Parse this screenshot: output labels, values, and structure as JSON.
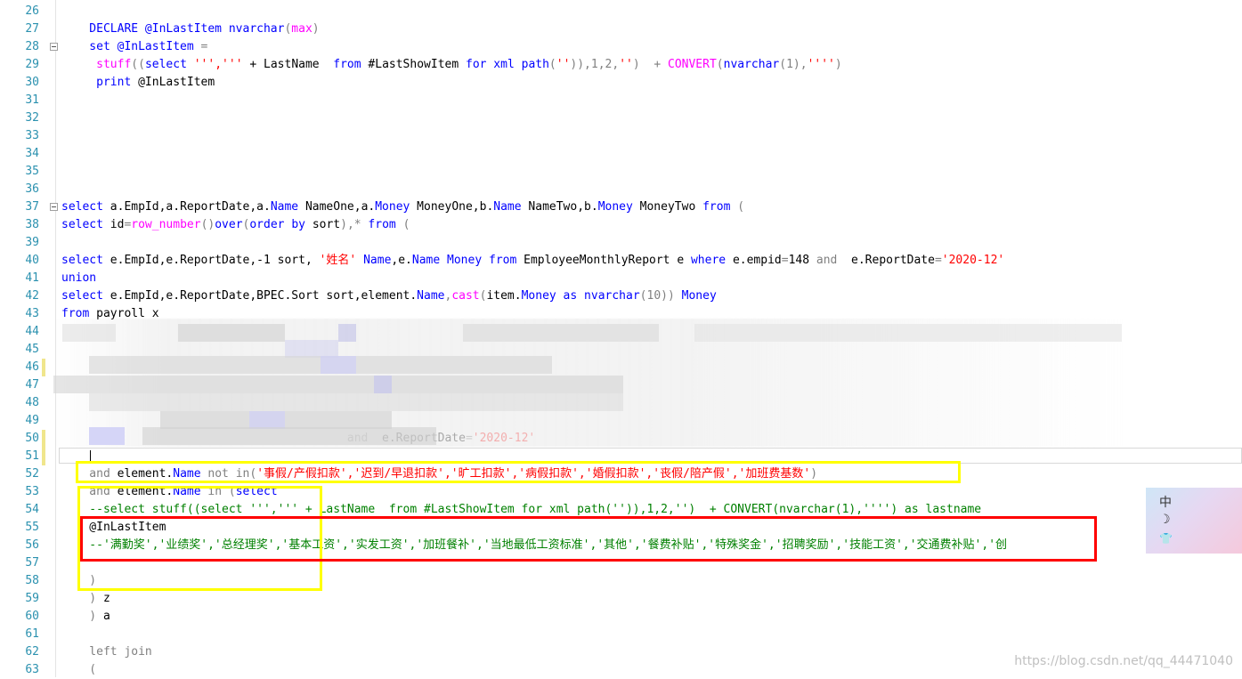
{
  "lines": [
    {
      "n": "26",
      "segs": []
    },
    {
      "n": "27",
      "segs": [
        {
          "t": "    DECLARE @InLastItem ",
          "c": "kw"
        },
        {
          "t": "nvarchar",
          "c": "kw"
        },
        {
          "t": "(",
          "c": "gr"
        },
        {
          "t": "max",
          "c": "fn"
        },
        {
          "t": ")",
          "c": "gr"
        }
      ]
    },
    {
      "n": "28",
      "segs": [
        {
          "t": "    set @InLastItem ",
          "c": "kw"
        },
        {
          "t": "=",
          "c": "gr"
        }
      ]
    },
    {
      "n": "29",
      "segs": [
        {
          "t": "     stuff",
          "c": "fn"
        },
        {
          "t": "((",
          "c": "gr"
        },
        {
          "t": "select ",
          "c": "kw"
        },
        {
          "t": "''','''",
          "c": "str"
        },
        {
          "t": " + LastName  ",
          "c": ""
        },
        {
          "t": "from ",
          "c": "kw"
        },
        {
          "t": "#LastShowItem ",
          "c": ""
        },
        {
          "t": "for xml path",
          "c": "kw"
        },
        {
          "t": "(",
          "c": "gr"
        },
        {
          "t": "''",
          "c": "str"
        },
        {
          "t": ")),1,2,",
          "c": "gr"
        },
        {
          "t": "''",
          "c": "str"
        },
        {
          "t": ")  + ",
          "c": "gr"
        },
        {
          "t": "CONVERT",
          "c": "fn"
        },
        {
          "t": "(",
          "c": "gr"
        },
        {
          "t": "nvarchar",
          "c": "kw"
        },
        {
          "t": "(1),",
          "c": "gr"
        },
        {
          "t": "''''",
          "c": "str"
        },
        {
          "t": ")",
          "c": "gr"
        }
      ]
    },
    {
      "n": "30",
      "segs": [
        {
          "t": "     print ",
          "c": "kw"
        },
        {
          "t": "@InLastItem",
          "c": ""
        }
      ]
    },
    {
      "n": "31",
      "segs": []
    },
    {
      "n": "32",
      "segs": []
    },
    {
      "n": "33",
      "segs": []
    },
    {
      "n": "34",
      "segs": []
    },
    {
      "n": "35",
      "segs": []
    },
    {
      "n": "36",
      "segs": []
    },
    {
      "n": "37",
      "segs": [
        {
          "t": "select ",
          "c": "kw"
        },
        {
          "t": "a.EmpId,a.ReportDate,a.",
          "c": ""
        },
        {
          "t": "Name",
          "c": "kw"
        },
        {
          "t": " NameOne,a.",
          "c": ""
        },
        {
          "t": "Money",
          "c": "kw"
        },
        {
          "t": " MoneyOne,b.",
          "c": ""
        },
        {
          "t": "Name",
          "c": "kw"
        },
        {
          "t": " NameTwo,b.",
          "c": ""
        },
        {
          "t": "Money",
          "c": "kw"
        },
        {
          "t": " MoneyTwo ",
          "c": ""
        },
        {
          "t": "from ",
          "c": "kw"
        },
        {
          "t": "(",
          "c": "gr"
        }
      ]
    },
    {
      "n": "38",
      "segs": [
        {
          "t": "select ",
          "c": "kw"
        },
        {
          "t": "id",
          "c": ""
        },
        {
          "t": "=",
          "c": "gr"
        },
        {
          "t": "row_number",
          "c": "fn"
        },
        {
          "t": "()",
          "c": "gr"
        },
        {
          "t": "over",
          "c": "kw"
        },
        {
          "t": "(",
          "c": "gr"
        },
        {
          "t": "order by ",
          "c": "kw"
        },
        {
          "t": "sort",
          "c": ""
        },
        {
          "t": "),*",
          "c": "gr"
        },
        {
          "t": " from ",
          "c": "kw"
        },
        {
          "t": "(",
          "c": "gr"
        }
      ]
    },
    {
      "n": "39",
      "segs": []
    },
    {
      "n": "40",
      "segs": [
        {
          "t": "select ",
          "c": "kw"
        },
        {
          "t": "e.EmpId,e.ReportDate,-1 sort, ",
          "c": ""
        },
        {
          "t": "'姓名'",
          "c": "str"
        },
        {
          "t": " Name",
          "c": "kw"
        },
        {
          "t": ",e.",
          "c": ""
        },
        {
          "t": "Name",
          "c": "kw"
        },
        {
          "t": " Money",
          "c": "kw"
        },
        {
          "t": " from ",
          "c": "kw"
        },
        {
          "t": "EmployeeMonthlyReport e ",
          "c": ""
        },
        {
          "t": "where ",
          "c": "kw"
        },
        {
          "t": "e.empid",
          "c": ""
        },
        {
          "t": "=",
          "c": "gr"
        },
        {
          "t": "148 ",
          "c": ""
        },
        {
          "t": "and",
          "c": "gr"
        },
        {
          "t": "  e.ReportDate",
          "c": ""
        },
        {
          "t": "=",
          "c": "gr"
        },
        {
          "t": "'2020-12'",
          "c": "str"
        }
      ]
    },
    {
      "n": "41",
      "segs": [
        {
          "t": "union",
          "c": "kw"
        }
      ]
    },
    {
      "n": "42",
      "segs": [
        {
          "t": "select ",
          "c": "kw"
        },
        {
          "t": "e.EmpId,e.ReportDate,BPEC.Sort sort,element.",
          "c": ""
        },
        {
          "t": "Name",
          "c": "kw"
        },
        {
          "t": ",",
          "c": "gr"
        },
        {
          "t": "cast",
          "c": "fn"
        },
        {
          "t": "(",
          "c": "gr"
        },
        {
          "t": "item.",
          "c": ""
        },
        {
          "t": "Money",
          "c": "kw"
        },
        {
          "t": " as ",
          "c": "kw"
        },
        {
          "t": "nvarchar",
          "c": "kw"
        },
        {
          "t": "(10)) ",
          "c": "gr"
        },
        {
          "t": "Money",
          "c": "kw"
        }
      ]
    },
    {
      "n": "43",
      "segs": [
        {
          "t": "from ",
          "c": "kw"
        },
        {
          "t": "payroll x",
          "c": ""
        }
      ]
    },
    {
      "n": "44",
      "segs": []
    },
    {
      "n": "45",
      "segs": []
    },
    {
      "n": "46",
      "segs": []
    },
    {
      "n": "47",
      "segs": []
    },
    {
      "n": "48",
      "segs": []
    },
    {
      "n": "49",
      "segs": []
    },
    {
      "n": "50",
      "segs": [
        {
          "t": "                                         and",
          "c": "gr"
        },
        {
          "t": "  e.ReportDate",
          "c": ""
        },
        {
          "t": "=",
          "c": "gr"
        },
        {
          "t": "'2020-12'",
          "c": "str"
        }
      ]
    },
    {
      "n": "51",
      "segs": []
    },
    {
      "n": "52",
      "segs": [
        {
          "t": "    and ",
          "c": "gr"
        },
        {
          "t": "element.",
          "c": ""
        },
        {
          "t": "Name",
          "c": "kw"
        },
        {
          "t": " not in",
          "c": "gr"
        },
        {
          "t": "(",
          "c": "gr"
        },
        {
          "t": "'事假/产假扣款','迟到/早退扣款','旷工扣款','病假扣款','婚假扣款','丧假/陪产假','加班费基数'",
          "c": "str"
        },
        {
          "t": ")",
          "c": "gr"
        }
      ]
    },
    {
      "n": "53",
      "segs": [
        {
          "t": "    and ",
          "c": "gr"
        },
        {
          "t": "element.",
          "c": ""
        },
        {
          "t": "Name",
          "c": "kw"
        },
        {
          "t": " in ",
          "c": "gr"
        },
        {
          "t": "(",
          "c": "gr"
        },
        {
          "t": "select",
          "c": "kw"
        }
      ]
    },
    {
      "n": "54",
      "segs": [
        {
          "t": "    --select stuff((select ''',''' + LastName  from #LastShowItem for xml path('')),1,2,'')  + CONVERT(nvarchar(1),'''') as lastname",
          "c": "cm"
        }
      ]
    },
    {
      "n": "55",
      "segs": [
        {
          "t": "    @InLastItem",
          "c": ""
        }
      ]
    },
    {
      "n": "56",
      "segs": [
        {
          "t": "    --'满勤奖','业绩奖','总经理奖','基本工资','实发工资','加班餐补','当地最低工资标准','其他','餐费补贴','特殊奖金','招聘奖励','技能工资','交通费补贴','创",
          "c": "cm"
        }
      ]
    },
    {
      "n": "57",
      "segs": []
    },
    {
      "n": "58",
      "segs": [
        {
          "t": "    )",
          "c": "gr"
        }
      ]
    },
    {
      "n": "59",
      "segs": [
        {
          "t": "    ) ",
          "c": "gr"
        },
        {
          "t": "z",
          "c": ""
        }
      ]
    },
    {
      "n": "60",
      "segs": [
        {
          "t": "    ) ",
          "c": "gr"
        },
        {
          "t": "a",
          "c": ""
        }
      ]
    },
    {
      "n": "61",
      "segs": []
    },
    {
      "n": "62",
      "segs": [
        {
          "t": "    left join",
          "c": "gr"
        }
      ]
    },
    {
      "n": "63",
      "segs": [
        {
          "t": "    (",
          "c": "gr"
        }
      ]
    }
  ],
  "ime": {
    "char": "中",
    "moon": "☽",
    "shirt": "👕"
  },
  "watermark": "https://blog.csdn.net/qq_44471040"
}
